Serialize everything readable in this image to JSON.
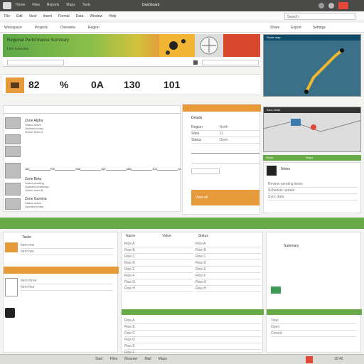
{
  "app": {
    "title": "Dashboard",
    "top_tabs": [
      "Home",
      "Files",
      "Reports",
      "Maps",
      "Tools"
    ],
    "window_buttons": [
      "minimize",
      "maximize",
      "close"
    ]
  },
  "toolbar": {
    "items": [
      "File",
      "Edit",
      "View",
      "Insert",
      "Format",
      "Data",
      "Window",
      "Help"
    ],
    "search_placeholder": "Search"
  },
  "nav": {
    "breadcrumbs": [
      "Workspace",
      "Projects",
      "Overview",
      "Region"
    ],
    "right_links": [
      "Share",
      "Export",
      "Settings"
    ]
  },
  "banner": {
    "title": "Regional Performance Summary",
    "subtitle": "Live overview"
  },
  "stats": {
    "values": [
      "82",
      "%",
      "0A",
      "130",
      "101"
    ]
  },
  "left_list": {
    "items": [
      {
        "label": "Zone Alpha",
        "lines": [
          "Status active",
          "Updated today",
          "Owner team A"
        ]
      },
      {
        "label": "Zone Beta",
        "lines": [
          "Status pending",
          "Updated yesterday",
          "Owner team B"
        ]
      },
      {
        "label": "Zone Gamma",
        "lines": [
          "Status active",
          "Updated today"
        ]
      }
    ]
  },
  "timeline": {
    "markers": [
      "Jan",
      "Feb",
      "Mar",
      "Apr",
      "May",
      "Jun",
      "Jul"
    ]
  },
  "mid_panel": {
    "header": "Details",
    "fields": [
      {
        "k": "Region",
        "v": "North"
      },
      {
        "k": "Sites",
        "v": "12"
      },
      {
        "k": "Status",
        "v": "Open"
      }
    ],
    "footer": "View all"
  },
  "right_maps": {
    "map1_label": "Route map",
    "map2_label": "Area detail",
    "legend": [
      "Route",
      "Stops"
    ]
  },
  "right_note": {
    "title": "Notes",
    "lines": [
      "Review pending items",
      "Schedule update",
      "Sync data"
    ]
  },
  "bottom": {
    "left_header": "Tasks",
    "left_items": [
      "Item one",
      "Item two",
      "Item three",
      "Item four"
    ],
    "col_headers": [
      "Name",
      "Value",
      "Status"
    ],
    "columns": [
      [
        "Row A",
        "Row B",
        "Row C",
        "Row D",
        "Row E",
        "Row F",
        "Row G",
        "Row H"
      ],
      [
        "Row A",
        "Row B",
        "Row C",
        "Row D",
        "Row E",
        "Row F",
        "Row G",
        "Row H"
      ],
      [
        "Row A",
        "Row B",
        "Row C",
        "Row D",
        "Row E",
        "Row F"
      ]
    ],
    "right_title": "Summary",
    "right_lines": [
      "Total",
      "Open",
      "Closed"
    ]
  },
  "taskbar": {
    "items": [
      "Start",
      "Files",
      "Browser",
      "Mail",
      "Maps"
    ],
    "clock": "10:42"
  },
  "colors": {
    "accent_green": "#69aa48",
    "accent_orange": "#e79a3a",
    "accent_red": "#e2483a",
    "dark_bar": "#4a4a48"
  }
}
